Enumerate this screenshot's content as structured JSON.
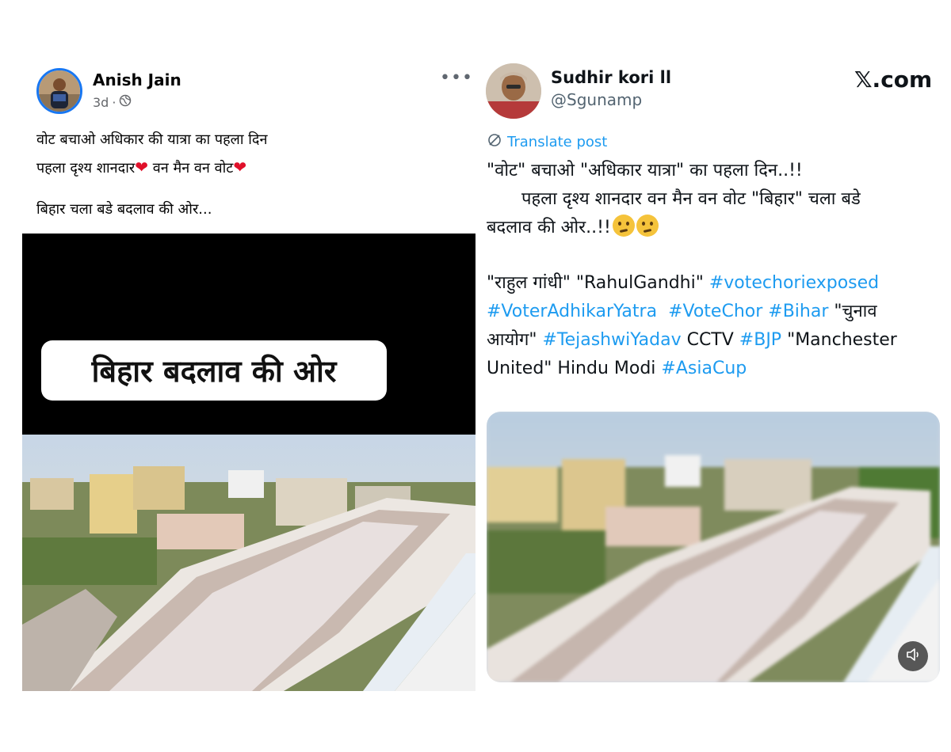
{
  "facebook_post": {
    "author": "Anish Jain",
    "time": "3d",
    "separator": "·",
    "more_label": "•••",
    "lines": [
      "वोट बचाओ अधिकार की यात्रा का पहला दिन",
      "पहला दृश्य शानदार",
      "वन मैन वन वोट",
      "बिहार चला बडे बदलाव की ओर..."
    ],
    "video_banner": "बिहार बदलाव की ओर",
    "icons": [
      "avatar",
      "globe-icon",
      "more-options-icon",
      "heart-emoji"
    ],
    "colors": {
      "avatar_ring": "#1877f2",
      "heart": "#e0102a"
    }
  },
  "x_post": {
    "display_name": "Sudhir kori ll",
    "handle": "@Sgunamp",
    "logo_text": "𝕏.com",
    "translate_label": "Translate post",
    "text_line1": "\"वोट\" बचाओ \"अधिकार यात्रा\" का पहला दिन..!!",
    "text_line2": "पहला दृश्य शानदार वन मैन वन वोट \"बिहार\" चला बडे",
    "text_line3": "बदलाव की ओर..!!",
    "line4_pre": "\"राहुल गांधी\" \"RahulGandhi\" ",
    "tag_votechoriexposed": "#votechoriexposed",
    "tag_voteradhikaryatra": "#VoterAdhikarYatra",
    "tag_votechor": "#VoteChor",
    "tag_bihar": "#Bihar",
    "line5_post": " \"चुनाव",
    "line6_pre": "आयोग\" ",
    "tag_tejashwiyadav": "#TejashwiYadav",
    "line6_mid": " CCTV ",
    "tag_bjp": "#BJP",
    "line6_post": " \"Manchester",
    "line7_pre": "United\" Hindu Modi ",
    "tag_asiacup": "#AsiaCup",
    "icons": [
      "translate-icon",
      "thinking-face-emoji",
      "mute-icon"
    ],
    "colors": {
      "hashtag": "#1d9bf0",
      "text": "#0f1419",
      "handle": "#536471"
    }
  }
}
